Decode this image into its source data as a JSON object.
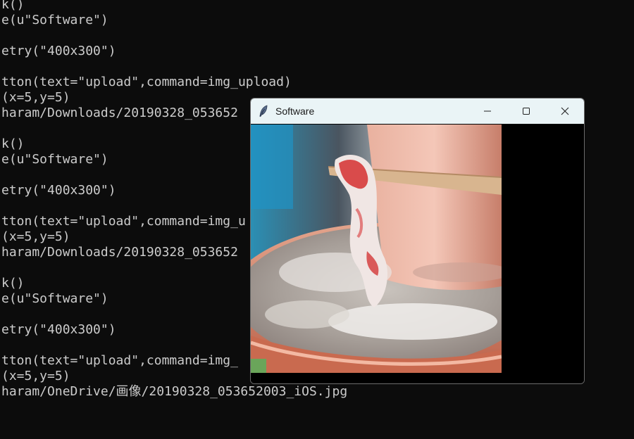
{
  "terminal": {
    "lines": [
      "k()",
      "e(u\"Software\")",
      "",
      "etry(\"400x300\")",
      "",
      "tton(text=\"upload\",command=img_upload)",
      "(x=5,y=5)",
      "haram/Downloads/20190328_053652",
      "",
      "k()",
      "e(u\"Software\")",
      "",
      "etry(\"400x300\")",
      "",
      "tton(text=\"upload\",command=img_u",
      "(x=5,y=5)",
      "haram/Downloads/20190328_053652",
      "",
      "k()",
      "e(u\"Software\")",
      "",
      "etry(\"400x300\")",
      "",
      "tton(text=\"upload\",command=img_",
      "(x=5,y=5)",
      "haram/OneDrive/画像/20190328_053652003_iOS.jpg"
    ]
  },
  "window": {
    "title": "Software",
    "icon": "feather-icon",
    "controls": [
      "minimize-icon",
      "maximize-icon",
      "close-icon"
    ]
  },
  "image": {
    "description_icon": "hotpot-photo"
  },
  "colors": {
    "terminal_bg": "#0c0c0c",
    "terminal_fg": "#cccccc",
    "titlebar": "#eaf4f6",
    "window_bg": "#000000"
  }
}
